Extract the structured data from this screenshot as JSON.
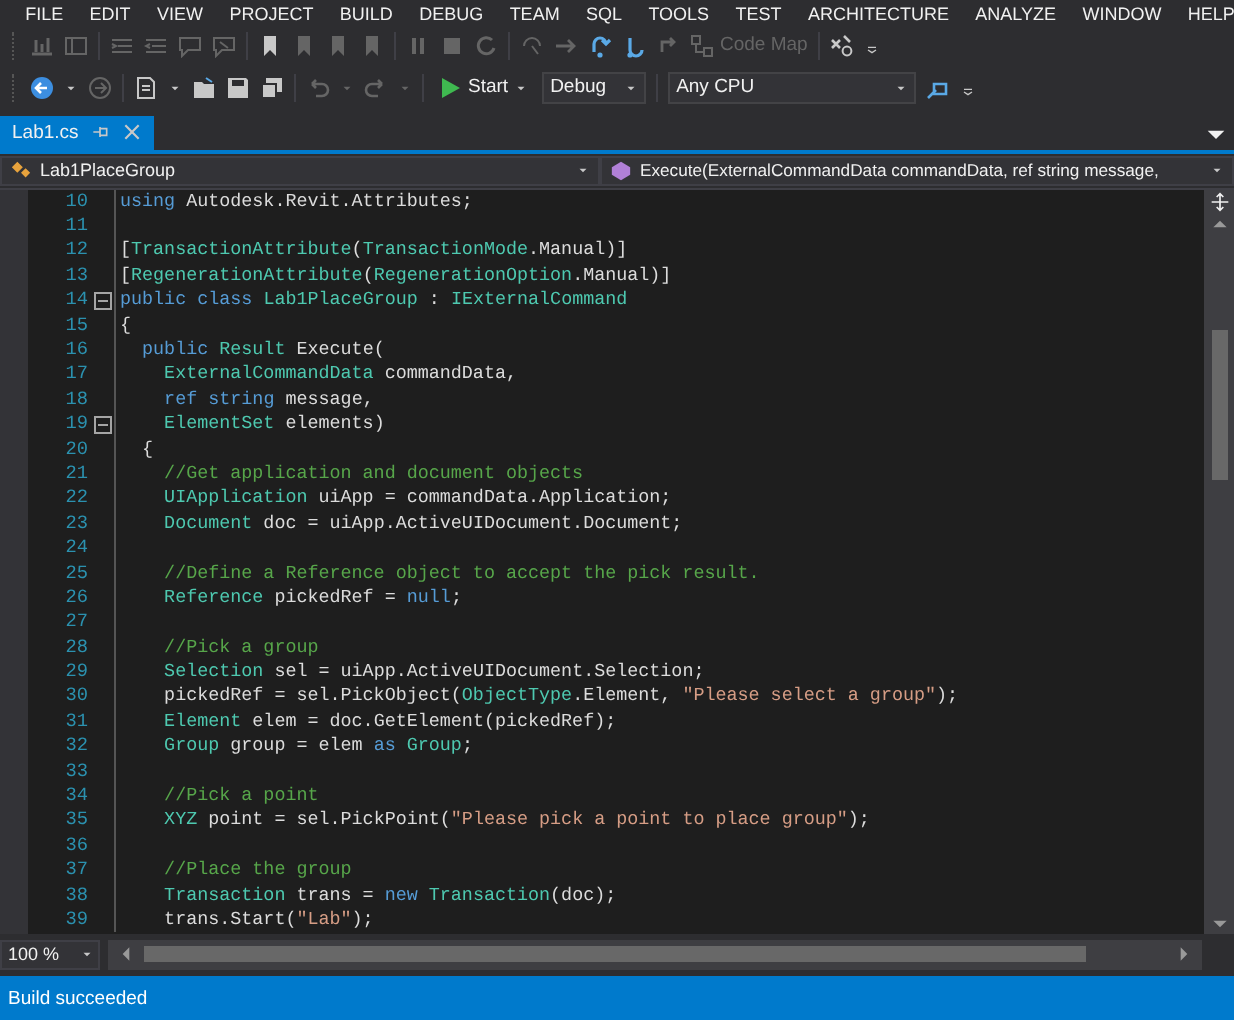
{
  "menu": [
    "FILE",
    "EDIT",
    "VIEW",
    "PROJECT",
    "BUILD",
    "DEBUG",
    "TEAM",
    "SQL",
    "TOOLS",
    "TEST",
    "ARCHITECTURE",
    "ANALYZE",
    "WINDOW",
    "HELP"
  ],
  "toolbar_1": {
    "code_map": {
      "label": "Code Map",
      "disabled": true
    }
  },
  "toolbar_2": {
    "start": "Start",
    "configuration": "Debug",
    "platform": "Any CPU"
  },
  "tabs": [
    {
      "label": "Lab1.cs",
      "selected": true
    }
  ],
  "navigation": {
    "type": "Lab1PlaceGroup",
    "member": "Execute(ExternalCommandData commandData, ref string message,"
  },
  "code_lines": [
    {
      "number": "10",
      "fold": false,
      "tokens": [
        {
          "kind": "kw",
          "text": "using"
        },
        {
          "kind": "plain",
          "text": " Autodesk.Revit.Attributes;"
        }
      ]
    },
    {
      "number": "11",
      "fold": false
    },
    {
      "number": "12",
      "fold": false,
      "tokens": [
        {
          "kind": "plain",
          "text": "["
        },
        {
          "kind": "type",
          "text": "TransactionAttribute"
        },
        {
          "kind": "plain",
          "text": "("
        },
        {
          "kind": "type",
          "text": "TransactionMode"
        },
        {
          "kind": "plain",
          "text": ".Manual)]"
        }
      ]
    },
    {
      "number": "13",
      "fold": false,
      "tokens": [
        {
          "kind": "plain",
          "text": "["
        },
        {
          "kind": "type",
          "text": "RegenerationAttribute"
        },
        {
          "kind": "plain",
          "text": "("
        },
        {
          "kind": "type",
          "text": "RegenerationOption"
        },
        {
          "kind": "plain",
          "text": ".Manual)]"
        }
      ]
    },
    {
      "number": "14",
      "fold": true,
      "tokens": [
        {
          "kind": "kw",
          "text": "public"
        },
        {
          "kind": "kw",
          "text": " class"
        },
        {
          "kind": "type",
          "text": " Lab1PlaceGroup"
        },
        {
          "kind": "plain",
          "text": " : "
        },
        {
          "kind": "type",
          "text": "IExternalCommand"
        }
      ]
    },
    {
      "number": "15",
      "fold": false,
      "tokens": [
        {
          "kind": "plain",
          "text": "{"
        }
      ]
    },
    {
      "number": "16",
      "fold": false,
      "tokens": [
        {
          "kind": "kw",
          "text": "  public"
        },
        {
          "kind": "type",
          "text": " Result"
        },
        {
          "kind": "plain",
          "text": " Execute("
        }
      ]
    },
    {
      "number": "17",
      "fold": false,
      "tokens": [
        {
          "kind": "type",
          "text": "    ExternalCommandData"
        },
        {
          "kind": "plain",
          "text": " commandData,"
        }
      ]
    },
    {
      "number": "18",
      "fold": false,
      "tokens": [
        {
          "kind": "kw",
          "text": "    ref"
        },
        {
          "kind": "kw",
          "text": " string"
        },
        {
          "kind": "plain",
          "text": " message,"
        }
      ]
    },
    {
      "number": "19",
      "fold": true,
      "tokens": [
        {
          "kind": "type",
          "text": "    ElementSet"
        },
        {
          "kind": "plain",
          "text": " elements)"
        }
      ]
    },
    {
      "number": "20",
      "fold": false,
      "tokens": [
        {
          "kind": "plain",
          "text": "  {"
        }
      ]
    },
    {
      "number": "21",
      "fold": false,
      "tokens": [
        {
          "kind": "comment",
          "text": "    //Get application and document objects"
        }
      ]
    },
    {
      "number": "22",
      "fold": false,
      "tokens": [
        {
          "kind": "type",
          "text": "    UIApplication"
        },
        {
          "kind": "plain",
          "text": " uiApp = commandData.Application;"
        }
      ]
    },
    {
      "number": "23",
      "fold": false,
      "tokens": [
        {
          "kind": "type",
          "text": "    Document"
        },
        {
          "kind": "plain",
          "text": " doc = uiApp.ActiveUIDocument.Document;"
        }
      ]
    },
    {
      "number": "24",
      "fold": false
    },
    {
      "number": "25",
      "fold": false,
      "tokens": [
        {
          "kind": "comment",
          "text": "    //Define a Reference object to accept the pick result."
        }
      ]
    },
    {
      "number": "26",
      "fold": false,
      "tokens": [
        {
          "kind": "type",
          "text": "    Reference"
        },
        {
          "kind": "plain",
          "text": " pickedRef = "
        },
        {
          "kind": "kw",
          "text": "null"
        },
        {
          "kind": "plain",
          "text": ";"
        }
      ]
    },
    {
      "number": "27",
      "fold": false
    },
    {
      "number": "28",
      "fold": false,
      "tokens": [
        {
          "kind": "comment",
          "text": "    //Pick a group"
        }
      ]
    },
    {
      "number": "29",
      "fold": false,
      "tokens": [
        {
          "kind": "type",
          "text": "    Selection"
        },
        {
          "kind": "plain",
          "text": " sel = uiApp.ActiveUIDocument.Selection;"
        }
      ]
    },
    {
      "number": "30",
      "fold": false,
      "tokens": [
        {
          "kind": "plain",
          "text": "    pickedRef = sel.PickObject("
        },
        {
          "kind": "type",
          "text": "ObjectType"
        },
        {
          "kind": "plain",
          "text": ".Element, "
        },
        {
          "kind": "str",
          "text": "\"Please select a group\""
        },
        {
          "kind": "plain",
          "text": ");"
        }
      ]
    },
    {
      "number": "31",
      "fold": false,
      "tokens": [
        {
          "kind": "type",
          "text": "    Element"
        },
        {
          "kind": "plain",
          "text": " elem = doc.GetElement(pickedRef);"
        }
      ]
    },
    {
      "number": "32",
      "fold": false,
      "tokens": [
        {
          "kind": "type",
          "text": "    Group"
        },
        {
          "kind": "plain",
          "text": " group = elem "
        },
        {
          "kind": "kw",
          "text": "as"
        },
        {
          "kind": "type",
          "text": " Group"
        },
        {
          "kind": "plain",
          "text": ";"
        }
      ]
    },
    {
      "number": "33",
      "fold": false
    },
    {
      "number": "34",
      "fold": false,
      "tokens": [
        {
          "kind": "comment",
          "text": "    //Pick a point"
        }
      ]
    },
    {
      "number": "35",
      "fold": false,
      "tokens": [
        {
          "kind": "type",
          "text": "    XYZ"
        },
        {
          "kind": "plain",
          "text": " point = sel.PickPoint("
        },
        {
          "kind": "str",
          "text": "\"Please pick a point to place group\""
        },
        {
          "kind": "plain",
          "text": ");"
        }
      ]
    },
    {
      "number": "36",
      "fold": false
    },
    {
      "number": "37",
      "fold": false,
      "tokens": [
        {
          "kind": "comment",
          "text": "    //Place the group"
        }
      ]
    },
    {
      "number": "38",
      "fold": false,
      "tokens": [
        {
          "kind": "type",
          "text": "    Transaction"
        },
        {
          "kind": "plain",
          "text": " trans = "
        },
        {
          "kind": "kw",
          "text": "new"
        },
        {
          "kind": "type",
          "text": " Transaction"
        },
        {
          "kind": "plain",
          "text": "(doc);"
        }
      ]
    },
    {
      "number": "39",
      "fold": false,
      "tokens": [
        {
          "kind": "plain",
          "text": "    trans.Start("
        },
        {
          "kind": "str",
          "text": "\"Lab\""
        },
        {
          "kind": "plain",
          "text": ");"
        }
      ]
    }
  ],
  "zoom": "100 %",
  "status_bar": "Build succeeded"
}
